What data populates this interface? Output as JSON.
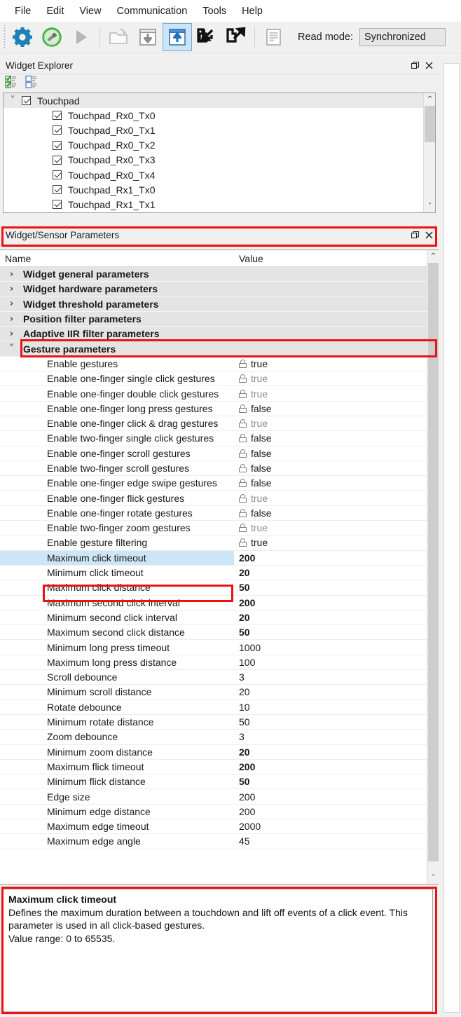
{
  "menu": {
    "items": [
      {
        "label": "File"
      },
      {
        "label": "Edit"
      },
      {
        "label": "View"
      },
      {
        "label": "Communication"
      },
      {
        "label": "Tools"
      },
      {
        "label": "Help"
      }
    ]
  },
  "toolbar": {
    "buttons": [
      {
        "name": "settings-gear-icon",
        "title": "Settings"
      },
      {
        "name": "connect-usb-icon",
        "title": "Connect"
      },
      {
        "name": "play-icon",
        "title": "Run"
      },
      {
        "name": "open-folder-icon",
        "title": "Open"
      },
      {
        "name": "download-to-device-icon",
        "title": "Read from device"
      },
      {
        "name": "upload-from-device-icon",
        "title": "Write to device"
      },
      {
        "name": "import-arrow-icon",
        "title": "Import"
      },
      {
        "name": "export-arrow-icon",
        "title": "Export"
      },
      {
        "name": "report-document-icon",
        "title": "Report"
      }
    ],
    "read_mode_label": "Read mode:",
    "read_mode_value": "Synchronized"
  },
  "widget_explorer": {
    "title": "Widget Explorer",
    "float_button": "float-icon",
    "close_button": "close-icon",
    "tools": [
      {
        "name": "check-all-icon"
      },
      {
        "name": "uncheck-all-icon"
      }
    ],
    "tree": [
      {
        "label": "Touchpad",
        "checked": true,
        "root": true,
        "expanded": true
      },
      {
        "label": "Touchpad_Rx0_Tx0",
        "checked": true,
        "root": false
      },
      {
        "label": "Touchpad_Rx0_Tx1",
        "checked": true,
        "root": false
      },
      {
        "label": "Touchpad_Rx0_Tx2",
        "checked": true,
        "root": false
      },
      {
        "label": "Touchpad_Rx0_Tx3",
        "checked": true,
        "root": false
      },
      {
        "label": "Touchpad_Rx0_Tx4",
        "checked": true,
        "root": false
      },
      {
        "label": "Touchpad_Rx1_Tx0",
        "checked": true,
        "root": false
      },
      {
        "label": "Touchpad_Rx1_Tx1",
        "checked": true,
        "root": false
      }
    ]
  },
  "parameters_panel": {
    "title": "Widget/Sensor Parameters",
    "float_button": "float-icon",
    "close_button": "close-icon",
    "columns": {
      "name": "Name",
      "value": "Value"
    },
    "rows": [
      {
        "type": "group",
        "name": "Widget general parameters",
        "value": "",
        "expanded": false
      },
      {
        "type": "group",
        "name": "Widget hardware parameters",
        "value": "",
        "expanded": false
      },
      {
        "type": "group",
        "name": "Widget threshold parameters",
        "value": "",
        "expanded": false
      },
      {
        "type": "group",
        "name": "Position filter parameters",
        "value": "",
        "expanded": false
      },
      {
        "type": "group",
        "name": "Adaptive IIR filter parameters",
        "value": "",
        "expanded": false
      },
      {
        "type": "group",
        "name": "Gesture parameters",
        "value": "",
        "expanded": true,
        "highlight": true
      },
      {
        "type": "param",
        "name": "Enable gestures",
        "value": "true",
        "lock": true,
        "bold": false,
        "dim": false
      },
      {
        "type": "param",
        "name": "Enable one-finger single click gestures",
        "value": "true",
        "lock": true,
        "bold": false,
        "dim": true
      },
      {
        "type": "param",
        "name": "Enable one-finger double click gestures",
        "value": "true",
        "lock": true,
        "bold": false,
        "dim": true
      },
      {
        "type": "param",
        "name": "Enable one-finger long press gestures",
        "value": "false",
        "lock": true,
        "bold": false,
        "dim": false
      },
      {
        "type": "param",
        "name": "Enable one-finger click & drag gestures",
        "value": "true",
        "lock": true,
        "bold": false,
        "dim": true
      },
      {
        "type": "param",
        "name": "Enable two-finger single click gestures",
        "value": "false",
        "lock": true,
        "bold": false,
        "dim": false
      },
      {
        "type": "param",
        "name": "Enable one-finger scroll gestures",
        "value": "false",
        "lock": true,
        "bold": false,
        "dim": false
      },
      {
        "type": "param",
        "name": "Enable two-finger scroll gestures",
        "value": "false",
        "lock": true,
        "bold": false,
        "dim": false
      },
      {
        "type": "param",
        "name": "Enable one-finger edge swipe gestures",
        "value": "false",
        "lock": true,
        "bold": false,
        "dim": false
      },
      {
        "type": "param",
        "name": "Enable one-finger flick gestures",
        "value": "true",
        "lock": true,
        "bold": false,
        "dim": true
      },
      {
        "type": "param",
        "name": "Enable one-finger rotate gestures",
        "value": "false",
        "lock": true,
        "bold": false,
        "dim": false
      },
      {
        "type": "param",
        "name": "Enable two-finger zoom gestures",
        "value": "true",
        "lock": true,
        "bold": false,
        "dim": true
      },
      {
        "type": "param",
        "name": "Enable gesture filtering",
        "value": "true",
        "lock": true,
        "bold": false,
        "dim": false
      },
      {
        "type": "param",
        "name": "Maximum click timeout",
        "value": "200",
        "lock": false,
        "bold": true,
        "dim": false,
        "selected": true
      },
      {
        "type": "param",
        "name": "Minimum click timeout",
        "value": "20",
        "lock": false,
        "bold": true,
        "dim": false
      },
      {
        "type": "param",
        "name": "Maximum click distance",
        "value": "50",
        "lock": false,
        "bold": true,
        "dim": false
      },
      {
        "type": "param",
        "name": "Maximum second click interval",
        "value": "200",
        "lock": false,
        "bold": true,
        "dim": false
      },
      {
        "type": "param",
        "name": "Minimum second click interval",
        "value": "20",
        "lock": false,
        "bold": true,
        "dim": false
      },
      {
        "type": "param",
        "name": "Maximum second click distance",
        "value": "50",
        "lock": false,
        "bold": true,
        "dim": false
      },
      {
        "type": "param",
        "name": "Minimum long press timeout",
        "value": "1000",
        "lock": false,
        "bold": false,
        "dim": false
      },
      {
        "type": "param",
        "name": "Maximum long press distance",
        "value": "100",
        "lock": false,
        "bold": false,
        "dim": false
      },
      {
        "type": "param",
        "name": "Scroll debounce",
        "value": "3",
        "lock": false,
        "bold": false,
        "dim": false
      },
      {
        "type": "param",
        "name": "Minimum scroll distance",
        "value": "20",
        "lock": false,
        "bold": false,
        "dim": false
      },
      {
        "type": "param",
        "name": "Rotate debounce",
        "value": "10",
        "lock": false,
        "bold": false,
        "dim": false
      },
      {
        "type": "param",
        "name": "Minimum rotate distance",
        "value": "50",
        "lock": false,
        "bold": false,
        "dim": false
      },
      {
        "type": "param",
        "name": "Zoom debounce",
        "value": "3",
        "lock": false,
        "bold": false,
        "dim": false
      },
      {
        "type": "param",
        "name": "Minimum zoom distance",
        "value": "20",
        "lock": false,
        "bold": true,
        "dim": false
      },
      {
        "type": "param",
        "name": "Maximum flick timeout",
        "value": "200",
        "lock": false,
        "bold": true,
        "dim": false
      },
      {
        "type": "param",
        "name": "Minimum flick distance",
        "value": "50",
        "lock": false,
        "bold": true,
        "dim": false
      },
      {
        "type": "param",
        "name": "Edge size",
        "value": "200",
        "lock": false,
        "bold": false,
        "dim": false
      },
      {
        "type": "param",
        "name": "Minimum edge distance",
        "value": "200",
        "lock": false,
        "bold": false,
        "dim": false
      },
      {
        "type": "param",
        "name": "Maximum edge timeout",
        "value": "2000",
        "lock": false,
        "bold": false,
        "dim": false
      },
      {
        "type": "param",
        "name": "Maximum edge angle",
        "value": "45",
        "lock": false,
        "bold": false,
        "dim": false
      }
    ]
  },
  "description": {
    "title": "Maximum click timeout",
    "line1": "Defines the maximum duration between a touchdown and lift off events of a click event. This parameter is used in all click-based gestures.",
    "line2": "Value range: 0 to 65535."
  },
  "colors": {
    "annotation": "#ee1111",
    "selection": "#cde6f7",
    "group_row": "#e4e4e4",
    "chrome": "#f0f0f0"
  }
}
